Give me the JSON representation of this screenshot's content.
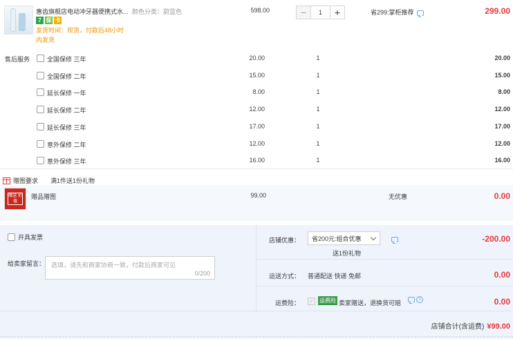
{
  "product": {
    "title": "惠齿旗舰店电动冲牙器便携式水...",
    "spec": "颜色分类：蔚蓝色",
    "badges": [
      "7",
      "保",
      "卡"
    ],
    "ship_time": "发货时间：现货，付款后48小时",
    "ship_note": "内发货",
    "unit_price": "598.00",
    "quantity": "1",
    "saving": "省299:掌柜推荐",
    "subtotal": "299.00"
  },
  "services": {
    "header": "售后服务",
    "items": [
      {
        "name": "全国保修 三年",
        "price": "20.00",
        "qty": "1",
        "total": "20.00"
      },
      {
        "name": "全国保修 二年",
        "price": "15.00",
        "qty": "1",
        "total": "15.00"
      },
      {
        "name": "延长保修 一年",
        "price": "8.00",
        "qty": "1",
        "total": "8.00"
      },
      {
        "name": "延长保修 二年",
        "price": "12.00",
        "qty": "1",
        "total": "12.00"
      },
      {
        "name": "延长保修 三年",
        "price": "17.00",
        "qty": "1",
        "total": "17.00"
      },
      {
        "name": "意外保修 二年",
        "price": "12.00",
        "qty": "1",
        "total": "12.00"
      },
      {
        "name": "意外保修 三年",
        "price": "16.00",
        "qty": "1",
        "total": "16.00"
      }
    ]
  },
  "gift": {
    "label": "赠图要求",
    "rule": "满1件送1份礼物",
    "thumb_text": "赠送\n价值",
    "name": "赠品赠图",
    "price": "99.00",
    "discount": "无优惠",
    "total": "0.00"
  },
  "invoice": {
    "label": "开具发票"
  },
  "message": {
    "label": "给卖家留言：",
    "placeholder": "选填，请先和商家协商一致，付款后商家可见",
    "counter": "0/200"
  },
  "promo": {
    "label": "店铺优惠：",
    "selected": "省200元:组合优惠",
    "gift_note": "送1份礼物",
    "amount": "-200.00"
  },
  "shipping": {
    "label": "运送方式：",
    "method": "普通配送 快递 免邮",
    "amount": "0.00"
  },
  "insurance": {
    "label": "运费险：",
    "tag": "运费险",
    "text": "卖家赠送，退换货可赔",
    "amount": "0.00"
  },
  "summary": {
    "label": "店铺合计(含运费)",
    "amount": "¥99.00"
  }
}
